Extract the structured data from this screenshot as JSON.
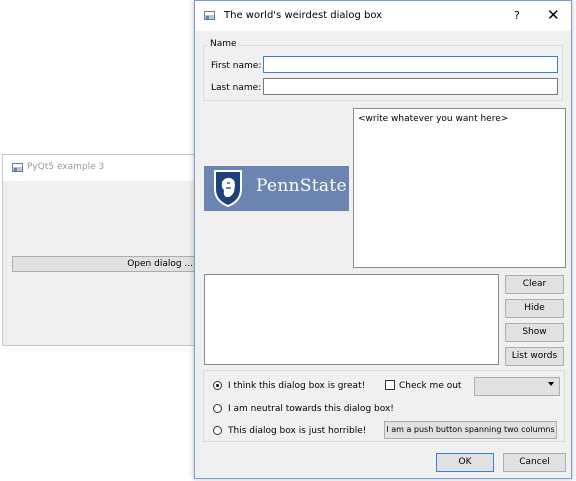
{
  "back_window": {
    "title": "PyQt5 example 3",
    "open_button": "Open dialog ..."
  },
  "dialog": {
    "title": "The world's weirdest dialog box",
    "help": "?",
    "close": "✕",
    "name_group": {
      "title": "Name",
      "first_label": "First name:",
      "first_value": "",
      "last_label": "Last name:",
      "last_value": ""
    },
    "logo_text": "PennState",
    "notes_text": "<write whatever you want here>",
    "list_text": "",
    "side_buttons": {
      "clear": "Clear",
      "hide": "Hide",
      "show": "Show",
      "list_words": "List words"
    },
    "options": {
      "radio1": "I think this dialog box is great!",
      "radio2": "I am neutral towards this dialog box!",
      "radio3": "This dialog box is just horrible!",
      "checkbox": "Check me out",
      "combo_value": "",
      "span_button": "I am a push button spanning two columns"
    },
    "footer": {
      "ok": "OK",
      "cancel": "Cancel"
    }
  },
  "colors": {
    "penn_blue": "#6c85b0",
    "focus_border": "#3c7fd9",
    "dialog_border": "#7a9cd3"
  }
}
